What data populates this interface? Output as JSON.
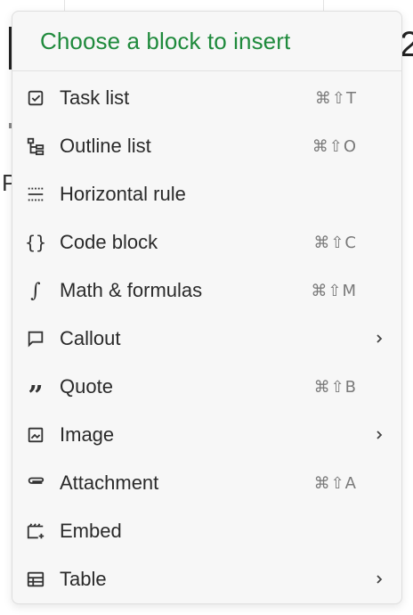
{
  "menu": {
    "title": "Choose a block to insert",
    "items": [
      {
        "label": "Task list",
        "shortcut": "⌘⇧T",
        "icon": "checkbox-icon"
      },
      {
        "label": "Outline list",
        "shortcut": "⌘⇧O",
        "icon": "outline-list-icon"
      },
      {
        "label": "Horizontal rule",
        "shortcut": "",
        "icon": "horizontal-rule-icon"
      },
      {
        "label": "Code block",
        "shortcut": "⌘⇧C",
        "icon": "code-braces-icon"
      },
      {
        "label": "Math & formulas",
        "shortcut": "⌘⇧M",
        "icon": "integral-icon"
      },
      {
        "label": "Callout",
        "shortcut": "",
        "icon": "speech-bubble-icon",
        "submenu": true
      },
      {
        "label": "Quote",
        "shortcut": "⌘⇧B",
        "icon": "quote-icon"
      },
      {
        "label": "Image",
        "shortcut": "",
        "icon": "image-icon",
        "submenu": true
      },
      {
        "label": "Attachment",
        "shortcut": "⌘⇧A",
        "icon": "paperclip-icon"
      },
      {
        "label": "Embed",
        "shortcut": "",
        "icon": "embed-icon"
      },
      {
        "label": "Table",
        "shortcut": "",
        "icon": "table-icon",
        "submenu": true
      }
    ]
  },
  "colors": {
    "title": "#1f8a3c",
    "menu_bg": "#f7f7f7"
  }
}
